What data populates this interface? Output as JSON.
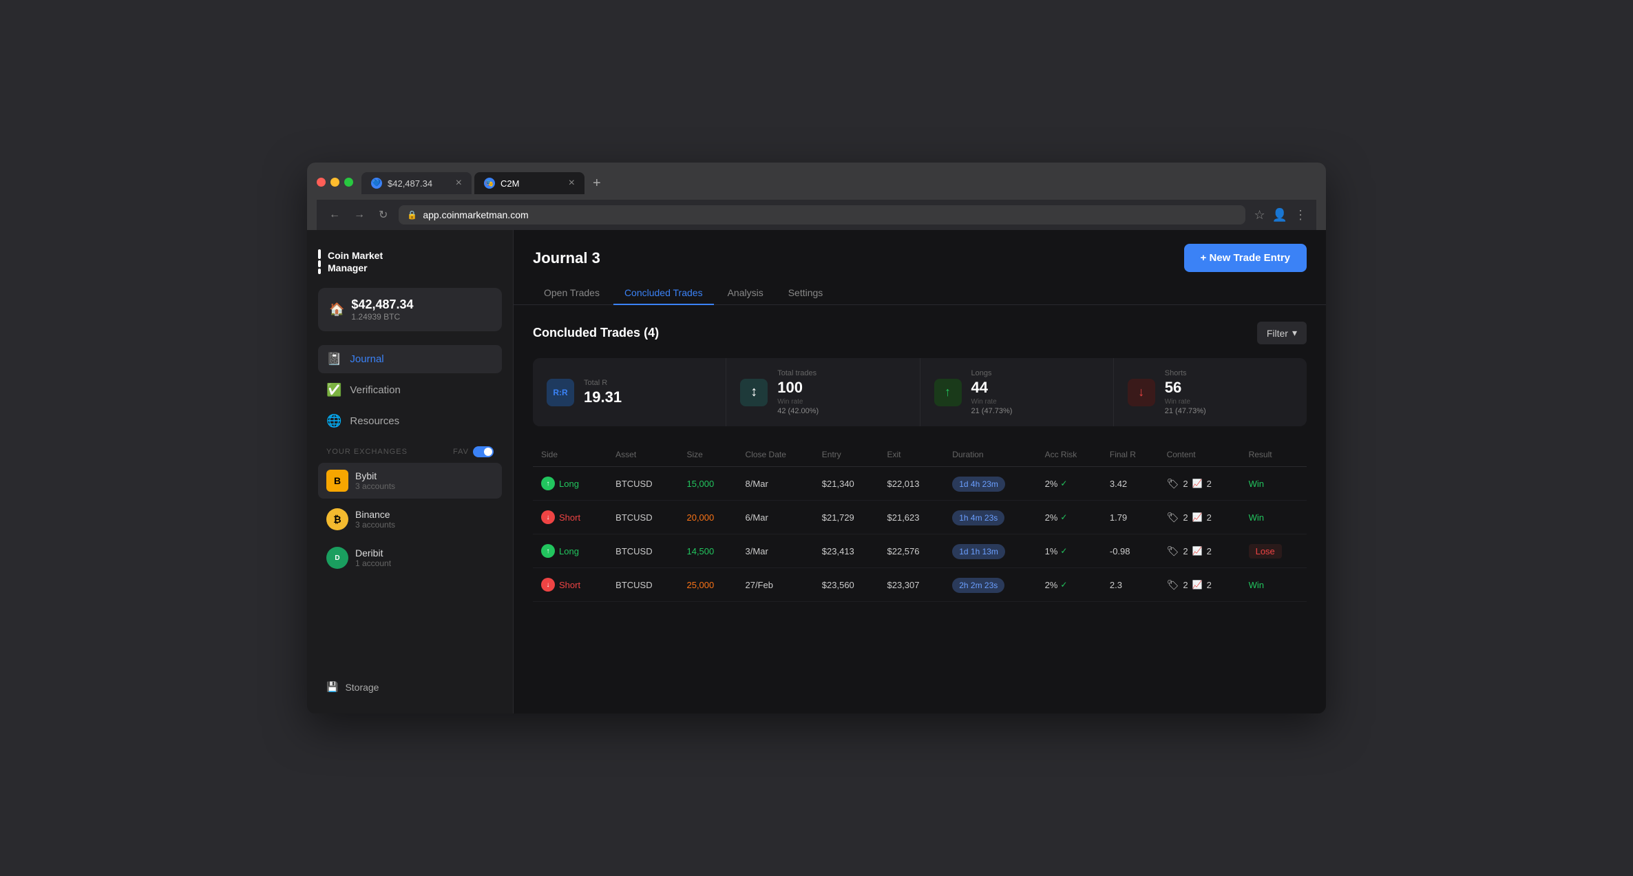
{
  "browser": {
    "tabs": [
      {
        "id": "tab-price",
        "label": "$42,487.34",
        "icon": "💙",
        "active": false
      },
      {
        "id": "tab-c2m",
        "label": "C2M",
        "icon": "🎭",
        "active": true
      }
    ],
    "new_tab_label": "+",
    "address": "app.coinmarketman.com",
    "nav": {
      "back": "←",
      "forward": "→",
      "refresh": "↻"
    }
  },
  "sidebar": {
    "logo_text_line1": "Coin Market",
    "logo_text_line2": "Manager",
    "balance": {
      "amount": "$42,487.34",
      "btc": "1.24939 BTC"
    },
    "nav_items": [
      {
        "id": "journal",
        "label": "Journal",
        "icon": "📓",
        "active": true
      },
      {
        "id": "verification",
        "label": "Verification",
        "icon": "✅",
        "active": false
      },
      {
        "id": "resources",
        "label": "Resources",
        "icon": "🌐",
        "active": false
      }
    ],
    "exchanges_label": "YOUR EXCHANGES",
    "fav_label": "FAV",
    "exchanges": [
      {
        "id": "bybit",
        "name": "Bybit",
        "accounts": "3 accounts",
        "color": "#f7a600",
        "letter": "B",
        "active": true
      },
      {
        "id": "binance",
        "name": "Binance",
        "accounts": "3 accounts",
        "color": "#f3ba2f",
        "letter": "B",
        "active": false
      },
      {
        "id": "deribit",
        "name": "Deribit",
        "accounts": "1 account",
        "color": "#1a9e5f",
        "letter": "D",
        "active": false
      }
    ],
    "storage_label": "Storage",
    "storage_icon": "💾"
  },
  "header": {
    "page_title": "Journal 3",
    "new_trade_btn": "+ New Trade Entry"
  },
  "tabs": [
    {
      "id": "open-trades",
      "label": "Open Trades",
      "active": false
    },
    {
      "id": "concluded-trades",
      "label": "Concluded Trades",
      "active": true
    },
    {
      "id": "analysis",
      "label": "Analysis",
      "active": false
    },
    {
      "id": "settings",
      "label": "Settings",
      "active": false
    }
  ],
  "concluded_trades": {
    "title": "Concluded Trades",
    "count": 4,
    "filter_btn": "Filter",
    "stats": {
      "rr": {
        "label": "Total R",
        "value": "19.31",
        "icon_text": "R:R"
      },
      "trades": {
        "label": "Total trades",
        "value": "100",
        "sub": "42 (42.00%)",
        "win_rate_label": "Win rate"
      },
      "longs": {
        "label": "Longs",
        "value": "44",
        "sub": "21 (47.73%)",
        "win_rate_label": "Win rate"
      },
      "shorts": {
        "label": "Shorts",
        "value": "56",
        "sub": "21 (47.73%)",
        "win_rate_label": "Win rate"
      }
    },
    "table": {
      "headers": [
        "Side",
        "Asset",
        "Size",
        "Close Date",
        "Entry",
        "Exit",
        "Duration",
        "Acc Risk",
        "Final R",
        "Content",
        "Result"
      ],
      "rows": [
        {
          "side": "Long",
          "side_type": "long",
          "asset": "BTCUSD",
          "size": "15,000",
          "size_color": "green",
          "close_date": "8/Mar",
          "entry": "$21,340",
          "exit": "$22,013",
          "duration": "1d 4h 23m",
          "acc_risk": "2%",
          "final_r": "3.42",
          "content_tags": "2",
          "content_charts": "2",
          "result": "Win",
          "result_type": "win"
        },
        {
          "side": "Short",
          "side_type": "short",
          "asset": "BTCUSD",
          "size": "20,000",
          "size_color": "orange",
          "close_date": "6/Mar",
          "entry": "$21,729",
          "exit": "$21,623",
          "duration": "1h 4m 23s",
          "acc_risk": "2%",
          "final_r": "1.79",
          "content_tags": "2",
          "content_charts": "2",
          "result": "Win",
          "result_type": "win"
        },
        {
          "side": "Long",
          "side_type": "long",
          "asset": "BTCUSD",
          "size": "14,500",
          "size_color": "green",
          "close_date": "3/Mar",
          "entry": "$23,413",
          "exit": "$22,576",
          "duration": "1d 1h 13m",
          "acc_risk": "1%",
          "final_r": "-0.98",
          "content_tags": "2",
          "content_charts": "2",
          "result": "Lose",
          "result_type": "lose"
        },
        {
          "side": "Short",
          "side_type": "short",
          "asset": "BTCUSD",
          "size": "25,000",
          "size_color": "orange",
          "close_date": "27/Feb",
          "entry": "$23,560",
          "exit": "$23,307",
          "duration": "2h 2m 23s",
          "acc_risk": "2%",
          "final_r": "2.3",
          "content_tags": "2",
          "content_charts": "2",
          "result": "Win",
          "result_type": "win"
        }
      ]
    }
  }
}
